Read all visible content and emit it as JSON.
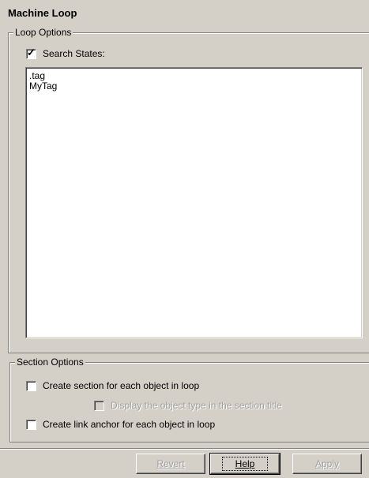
{
  "title": "Machine Loop",
  "loop_options": {
    "legend": "Loop Options",
    "search_states": {
      "label": "Search States:",
      "checked": true
    },
    "list_items": [
      ".tag",
      "MyTag"
    ]
  },
  "section_options": {
    "legend": "Section Options",
    "create_section": {
      "label": "Create section for each object in loop",
      "checked": false
    },
    "display_object_type": {
      "label": "Display the object type in the section title",
      "checked": false,
      "disabled": true
    },
    "create_link_anchor": {
      "label": "Create link anchor for each object in loop",
      "checked": false
    }
  },
  "buttons": {
    "revert": "Revert",
    "help": "Help",
    "apply": "Apply"
  },
  "icons": {
    "check": "check-icon"
  }
}
